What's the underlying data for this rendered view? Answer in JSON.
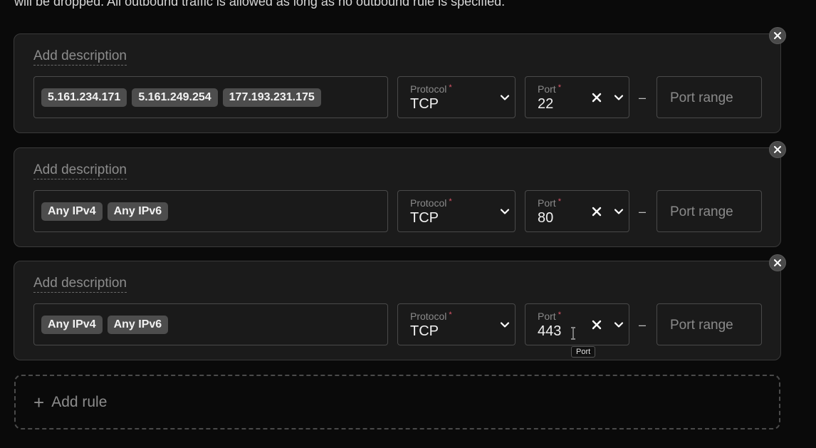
{
  "intro_text": "will be dropped. All outbound traffic is allowed as long as no outbound rule is specified.",
  "rules": [
    {
      "description_placeholder": "Add description",
      "sources": [
        "5.161.234.171",
        "5.161.249.254",
        "177.193.231.175"
      ],
      "protocol_label": "Protocol",
      "protocol_value": "TCP",
      "port_label": "Port",
      "port_value": "22",
      "port_range_placeholder": "Port range",
      "dash": "–"
    },
    {
      "description_placeholder": "Add description",
      "sources": [
        "Any IPv4",
        "Any IPv6"
      ],
      "protocol_label": "Protocol",
      "protocol_value": "TCP",
      "port_label": "Port",
      "port_value": "80",
      "port_range_placeholder": "Port range",
      "dash": "–"
    },
    {
      "description_placeholder": "Add description",
      "sources": [
        "Any IPv4",
        "Any IPv6"
      ],
      "protocol_label": "Protocol",
      "protocol_value": "TCP",
      "port_label": "Port",
      "port_value": "443",
      "port_range_placeholder": "Port range",
      "dash": "–"
    }
  ],
  "required_marker": "*",
  "add_rule": {
    "icon": "+",
    "label": "Add rule"
  },
  "tooltip": "Port",
  "icons": {
    "remove": "close-icon",
    "clear": "clear-icon",
    "chevron": "chevron-down-icon",
    "cursor": "text-cursor-icon"
  },
  "colors": {
    "background": "#0a0a0a",
    "card": "#1b1b1b",
    "chip": "#4d4d4d",
    "required": "#e0566a"
  }
}
